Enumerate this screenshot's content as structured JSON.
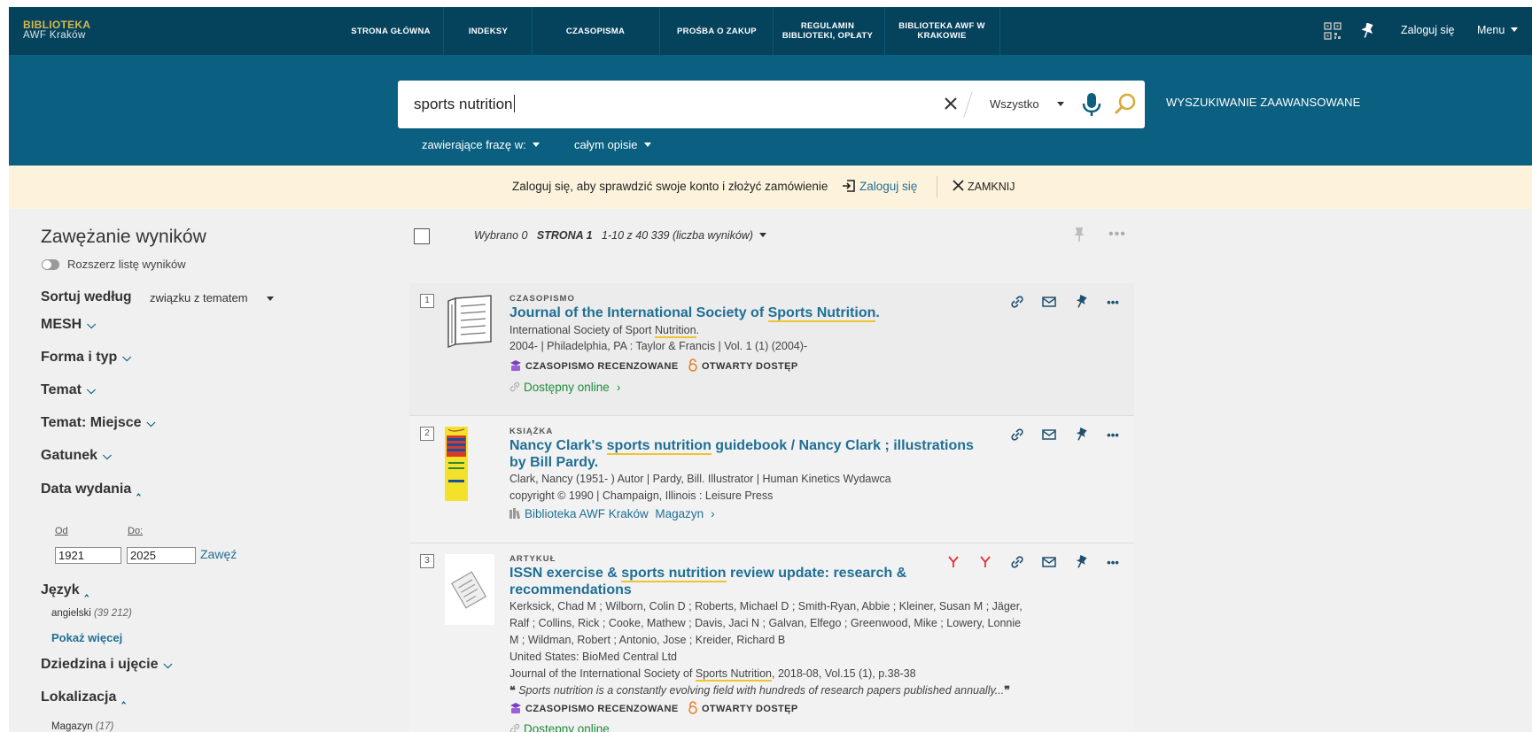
{
  "brand": {
    "line1": "BIBLIOTEKA",
    "line2": "AWF Kraków"
  },
  "nav": {
    "items": [
      "STRONA GŁÓWNA",
      "INDEKSY",
      "CZASOPISMA",
      "PROŚBA O ZAKUP",
      "REGULAMIN BIBLIOTEKI, OPŁATY",
      "BIBLIOTEKA AWF W KRAKOWIE"
    ],
    "login": "Zaloguj się",
    "menu": "Menu"
  },
  "search": {
    "query": "sports nutrition",
    "scope": "Wszystko",
    "advanced": "WYSZUKIWANIE ZAAWANSOWANE",
    "filter1": "zawierające frazę w:",
    "filter2": "całym opisie"
  },
  "banner": {
    "text": "Zaloguj się, aby sprawdzić swoje konto i złożyć zamówienie",
    "login": "Zaloguj się",
    "close": "ZAMKNIJ"
  },
  "sidebar": {
    "title": "Zawężanie wyników",
    "expand": "Rozszerz listę wyników",
    "sort_label": "Sortuj według",
    "sort_value": "związku z tematem",
    "facets": [
      "MESH",
      "Forma i typ",
      "Temat",
      "Temat: Miejsce",
      "Gatunek",
      "Data wydania",
      "Język",
      "Dziedzina i ujęcie",
      "Lokalizacja"
    ],
    "date_from_label": "Od",
    "date_to_label": "Do:",
    "date_from": "1921",
    "date_to": "2025",
    "narrow": "Zawęź",
    "lang_item": "angielski",
    "lang_count": "(39 212)",
    "show_more": "Pokaż więcej",
    "loc_item": "Magazyn",
    "loc_count": "(17)"
  },
  "results": {
    "selected": "Wybrano 0",
    "page": "STRONA 1",
    "range": "1-10 z 40 339 (liczba wyników)"
  },
  "records": [
    {
      "num": "1",
      "type": "CZASOPISMO",
      "title_a": "Journal of the International Society of ",
      "title_hl": "Sports Nutrition",
      "title_b": ".",
      "line1_a": "International Society of Sport ",
      "line1_hl": "Nutrition",
      "line1_b": ".",
      "line2": "2004- | Philadelphia, PA : Taylor & Francis | Vol. 1 (1) (2004)-",
      "badge1": "CZASOPISMO RECENZOWANE",
      "badge2": "OTWARTY DOSTĘP",
      "avail": "Dostępny online"
    },
    {
      "num": "2",
      "type": "KSIĄŻKA",
      "title_a": "Nancy Clark's ",
      "title_hl": "sports nutrition",
      "title_b": " guidebook / Nancy Clark ; illustrations",
      "title_c": "by Bill Pardy.",
      "line1": "Clark, Nancy (1951- ) Autor | Pardy, Bill. Illustrator | Human Kinetics Wydawca",
      "line2": "copyright © 1990 | Champaign, Illinois : Leisure Press",
      "loc": "Biblioteka AWF Kraków",
      "loc2": "Magazyn"
    },
    {
      "num": "3",
      "type": "ARTYKUŁ",
      "title_a": "ISSN exercise & ",
      "title_hl": "sports nutrition",
      "title_b": " review update: research &",
      "title_c": "recommendations",
      "authors1": "Kerksick, Chad M ; Wilborn, Colin D ; Roberts, Michael D ; Smith-Ryan, Abbie ; Kleiner, Susan M ; Jäger,",
      "authors2": "Ralf ; Collins, Rick ; Cooke, Mathew ; Davis, Jaci N ; Galvan, Elfego ; Greenwood, Mike ; Lowery, Lonnie",
      "authors3": "M ; Wildman, Robert ; Antonio, Jose ; Kreider, Richard B",
      "publisher": "United States: BioMed Central Ltd",
      "source_a": "Journal of the International Society of ",
      "source_hl": "Sports Nutrition",
      "source_b": ", 2018-08, Vol.15 (1), p.38-38",
      "snippet": "Sports nutrition is a constantly evolving field with hundreds of research papers published annually...",
      "badge1": "CZASOPISMO RECENZOWANE",
      "badge2": "OTWARTY DOSTĘP",
      "avail": "Dostępny online"
    }
  ],
  "colors": {
    "nav": "#05435d",
    "search": "#0b5f80",
    "link": "#1f6f95",
    "green": "#1e8b3a",
    "highlight": "#f0c430",
    "banner": "#fdf3dd"
  }
}
